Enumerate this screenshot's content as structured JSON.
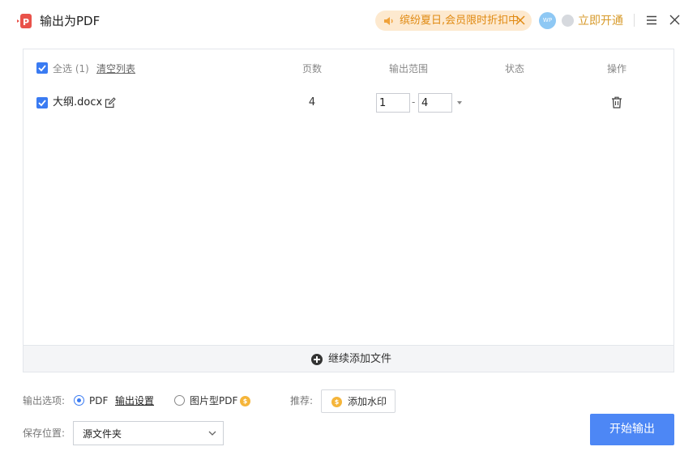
{
  "window": {
    "title": "输出为PDF",
    "promo_text": "缤纷夏日,会员限时折扣中",
    "avatar_text": "WP",
    "vip_label": "立即开通"
  },
  "file_list": {
    "select_all_label": "全选 (1)",
    "clear_list_label": "清空列表",
    "columns": {
      "pages": "页数",
      "range": "输出范围",
      "status": "状态",
      "actions": "操作"
    },
    "rows": [
      {
        "checked": true,
        "name": "大纲.docx",
        "pages": "4",
        "range_from": "1",
        "range_to": "4",
        "range_dash": "-",
        "status": ""
      }
    ],
    "add_more_label": "继续添加文件"
  },
  "options": {
    "output_options_label": "输出选项:",
    "pdf_label": "PDF",
    "output_settings_label": "输出设置",
    "image_pdf_label": "图片型PDF",
    "recommend_label": "推荐:",
    "watermark_label": "添加水印",
    "save_location_label": "保存位置:",
    "save_location_value": "源文件夹",
    "start_label": "开始输出",
    "selected_mode": "PDF"
  },
  "colors": {
    "accent": "#4d87f5",
    "checkbox": "#3a7bf2",
    "promo_bg": "#fde9cf",
    "promo_text": "#e08a12",
    "vip_text": "#d79a2a",
    "logo": "#e9524a",
    "coin": "#f5b53a"
  }
}
